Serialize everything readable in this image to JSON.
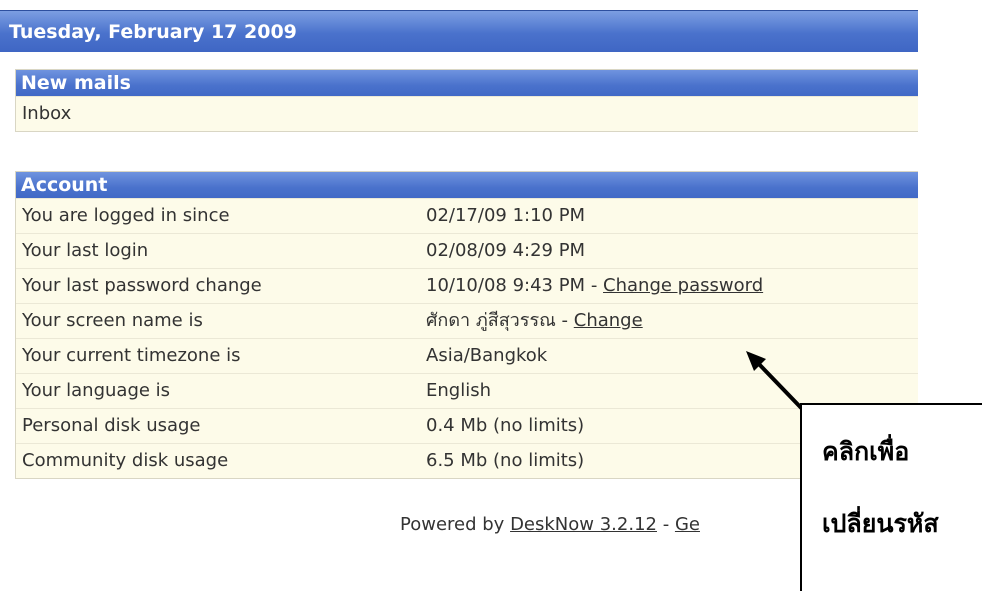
{
  "date_header": "Tuesday, February 17 2009",
  "new_mails": {
    "title": "New mails",
    "items": [
      {
        "label": "Inbox"
      }
    ]
  },
  "account": {
    "title": "Account",
    "rows": [
      {
        "label": "You are logged in since",
        "value": "02/17/09 1:10 PM",
        "link": ""
      },
      {
        "label": "Your last login",
        "value": "02/08/09 4:29 PM",
        "link": ""
      },
      {
        "label": "Your last password change",
        "value": "10/10/08 9:43 PM - ",
        "link": "Change password"
      },
      {
        "label": "Your screen name is",
        "value": "ศักดา ภู่สีสุวรรณ - ",
        "link": "Change"
      },
      {
        "label": "Your current timezone is",
        "value": "Asia/Bangkok",
        "link": ""
      },
      {
        "label": "Your language is",
        "value": "English",
        "link": ""
      },
      {
        "label": "Personal disk usage",
        "value": "0.4 Mb (no limits)",
        "link": ""
      },
      {
        "label": "Community disk usage",
        "value": "6.5 Mb (no limits)",
        "link": ""
      }
    ]
  },
  "footer": {
    "prefix": "Powered by ",
    "product_link": "DeskNow 3.2.12",
    "separator": " - ",
    "extra_link": "Ge"
  },
  "callout": {
    "line1": "คลิกเพื่อ",
    "line2": "เปลี่ยนรหัส"
  }
}
